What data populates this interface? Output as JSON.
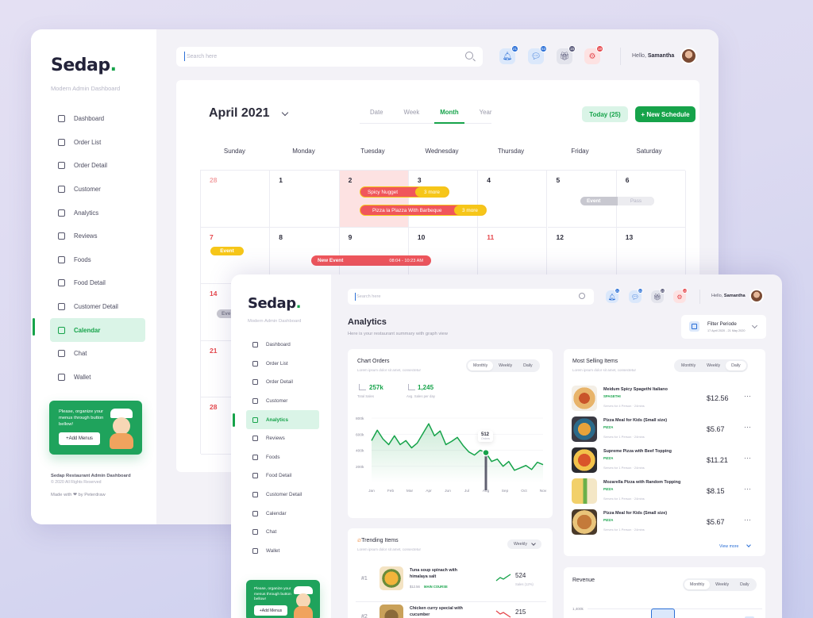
{
  "brand": {
    "name": "Sedap",
    "dot": ".",
    "tagline": "Modern Admin Dashboard"
  },
  "back": {
    "nav": [
      {
        "label": "Dashboard",
        "icon": "home-icon"
      },
      {
        "label": "Order List",
        "icon": "list-icon"
      },
      {
        "label": "Order Detail",
        "icon": "document-icon"
      },
      {
        "label": "Customer",
        "icon": "user-icon"
      },
      {
        "label": "Analytics",
        "icon": "chart-icon"
      },
      {
        "label": "Reviews",
        "icon": "pen-icon"
      },
      {
        "label": "Foods",
        "icon": "food-icon"
      },
      {
        "label": "Food Detail",
        "icon": "food-detail-icon"
      },
      {
        "label": "Customer Detail",
        "icon": "customer-detail-icon"
      },
      {
        "label": "Calendar",
        "icon": "calendar-icon",
        "active": true
      },
      {
        "label": "Chat",
        "icon": "chat-icon"
      },
      {
        "label": "Wallet",
        "icon": "wallet-icon"
      }
    ],
    "promo": {
      "text": "Please, organize your menus through button bellow!",
      "button": "+Add Menus"
    },
    "footer": {
      "title": "Sedap Restaurant Admin Dashboard",
      "copyright": "© 2020 All Rights Reserved",
      "made": "Made with ❤ by Peterdraw"
    },
    "search_placeholder": "Search here",
    "header": {
      "badges": [
        "21",
        "53",
        "15",
        "19"
      ],
      "hello": "Hello,",
      "user": "Samantha"
    },
    "calendar": {
      "month": "April 2021",
      "tabs": [
        "Date",
        "Week",
        "Month",
        "Year"
      ],
      "active_tab": "Month",
      "today_button": "Today (25)",
      "new_button": "+ New Schedule",
      "days": [
        "Sunday",
        "Monday",
        "Tuesday",
        "Wednesday",
        "Thursday",
        "Friday",
        "Saturday"
      ],
      "dates_row1": [
        "28",
        "1",
        "2",
        "3",
        "4",
        "5",
        "6"
      ],
      "dates_row2": [
        "7",
        "8",
        "9",
        "10",
        "11",
        "12",
        "13"
      ],
      "dates_col0": [
        "14",
        "21",
        "28"
      ],
      "events": {
        "spicy": "Spicy Nugget",
        "pizza": "Pizza la Plazza With Barbeque",
        "more": "3 more",
        "event": "Event",
        "pass": "Pass",
        "new_event": "New Event",
        "new_event_time": "08:04 - 10:23 AM",
        "event_short": "Eve"
      }
    }
  },
  "front": {
    "nav": [
      {
        "label": "Dashboard"
      },
      {
        "label": "Order List"
      },
      {
        "label": "Order Detail"
      },
      {
        "label": "Customer"
      },
      {
        "label": "Analytics",
        "active": true
      },
      {
        "label": "Reviews"
      },
      {
        "label": "Foods"
      },
      {
        "label": "Food Detail"
      },
      {
        "label": "Customer Detail"
      },
      {
        "label": "Calendar"
      },
      {
        "label": "Chat"
      },
      {
        "label": "Wallet"
      }
    ],
    "promo": {
      "text": "Please, organize your menus through button bellow!",
      "button": "+Add Menus"
    },
    "search_placeholder": "Search here",
    "header": {
      "badges": [
        "21",
        "53",
        "15",
        "19"
      ],
      "hello": "Hello,",
      "user": "Samantha"
    },
    "title": "Analytics",
    "description": "Here is your restaurant summary with graph view",
    "filter": {
      "label": "Filter Periode",
      "range": "17 April 2020 - 21 May 2020"
    },
    "chart_orders": {
      "title": "Chart Orders",
      "subtitle": "Lorem ipsum dolor sit amet, consectetur",
      "periods": [
        "Monthly",
        "Weekly",
        "Daily"
      ],
      "active_period": "Monthly",
      "stat1": {
        "value": "257k",
        "label": "Total Sales"
      },
      "stat2": {
        "value": "1,245",
        "label": "Avg. Sales per day"
      },
      "tooltip": {
        "value": "512",
        "label": "Orders"
      }
    },
    "most_selling": {
      "title": "Most Selling Items",
      "subtitle": "Lorem ipsum dolor sit amet, consectetur",
      "periods": [
        "Monthly",
        "Weekly",
        "Daily"
      ],
      "active_period": "Daily",
      "items": [
        {
          "name": "Meidum Spicy Spagethi Italiano",
          "category": "SPAGETHI",
          "meta": "Serves for 4 Person  ·  24mins",
          "price": "$12.56"
        },
        {
          "name": "Pizza Meal for Kids (Small size)",
          "category": "PIZZA",
          "meta": "Serves for 1 Person  ·  24mins",
          "price": "$5.67"
        },
        {
          "name": "Supreme Pizza with Beef Topping",
          "category": "PIZZA",
          "meta": "Serves for 1 Person  ·  24mins",
          "price": "$11.21"
        },
        {
          "name": "Mozarella Pizza with Random Topping",
          "category": "PIZZA",
          "meta": "Serves for 1 Person  ·  24mins",
          "price": "$8.15"
        },
        {
          "name": "Pizza Meal for Kids (Small size)",
          "category": "PIZZA",
          "meta": "Serves for 1 Person  ·  24mins",
          "price": "$5.67"
        }
      ],
      "view_more": "View more"
    },
    "trending": {
      "title": "Trending Items",
      "subtitle": "Lorem ipsum dolor sit amet, consectetur",
      "period": "Weekly",
      "items": [
        {
          "rank": "#1",
          "name": "Tuna soup spinach with himalaya salt",
          "price": "$12.56",
          "category": "MAIN COURSE",
          "value": "524",
          "label": "Sales (12%)"
        },
        {
          "rank": "#2",
          "name": "Chicken curry special with cucumber",
          "value": "215"
        }
      ]
    },
    "revenue": {
      "title": "Revenue",
      "periods": [
        "Monthly",
        "Weekly",
        "Daily"
      ],
      "active_period": "Monthly",
      "tick": "1,400k"
    }
  },
  "chart_data": {
    "type": "line",
    "title": "Chart Orders",
    "x": [
      "Jan",
      "Feb",
      "Mar",
      "Apr",
      "Jun",
      "Jul",
      "Aug",
      "Sep",
      "Oct",
      "Nov"
    ],
    "y_ticks": [
      "800k",
      "600k",
      "400k",
      "200k"
    ],
    "ylim": [
      0,
      850
    ],
    "series": [
      {
        "points": [
          [
            0,
            520
          ],
          [
            0.3,
            650
          ],
          [
            0.6,
            540
          ],
          [
            0.9,
            470
          ],
          [
            1.2,
            580
          ],
          [
            1.5,
            470
          ],
          [
            1.8,
            520
          ],
          [
            2.1,
            430
          ],
          [
            2.4,
            490
          ],
          [
            2.7,
            610
          ],
          [
            3.0,
            730
          ],
          [
            3.3,
            580
          ],
          [
            3.6,
            640
          ],
          [
            3.9,
            470
          ],
          [
            4.2,
            510
          ],
          [
            4.5,
            560
          ],
          [
            4.8,
            460
          ],
          [
            5.1,
            380
          ],
          [
            5.4,
            340
          ],
          [
            5.7,
            400
          ],
          [
            6.0,
            370
          ],
          [
            6.3,
            260
          ],
          [
            6.6,
            290
          ],
          [
            6.9,
            200
          ],
          [
            7.2,
            260
          ],
          [
            7.5,
            150
          ],
          [
            7.8,
            180
          ],
          [
            8.1,
            210
          ],
          [
            8.4,
            160
          ],
          [
            8.7,
            250
          ],
          [
            9.0,
            220
          ]
        ]
      }
    ],
    "highlight": {
      "x": 6.0,
      "y": 370,
      "label": "512"
    },
    "grid": true
  }
}
